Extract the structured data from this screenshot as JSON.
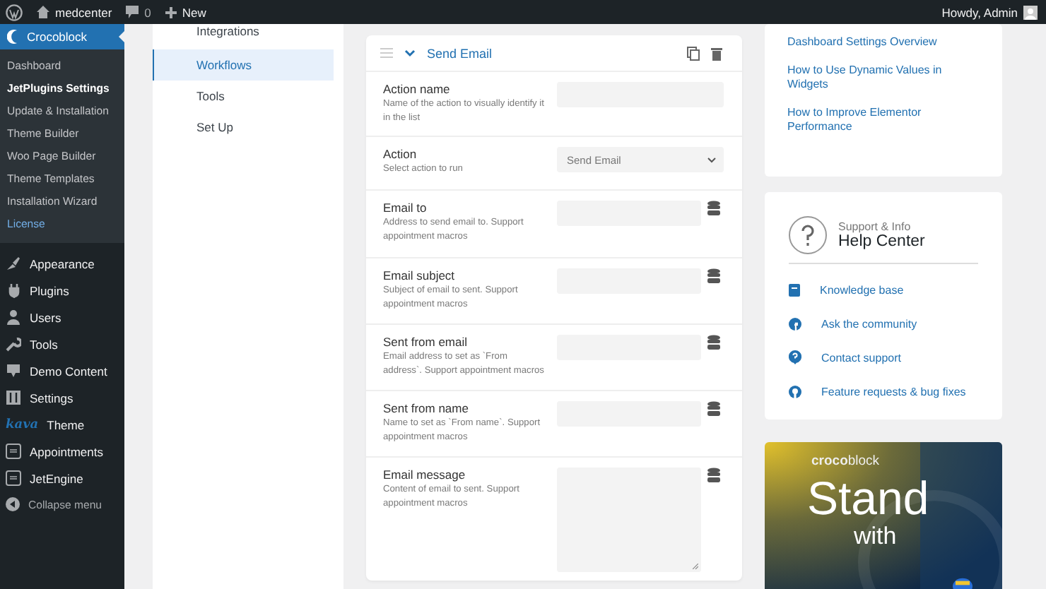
{
  "admin_bar": {
    "site": "medcenter",
    "comments": "0",
    "new": "New",
    "greeting": "Howdy, Admin"
  },
  "sidebar": {
    "header": "Crocoblock",
    "submenu": [
      {
        "label": "Dashboard",
        "selected": false,
        "kind": "plain"
      },
      {
        "label": "JetPlugins Settings",
        "selected": true,
        "kind": "plain"
      },
      {
        "label": "Update & Installation",
        "selected": false,
        "kind": "plain"
      },
      {
        "label": "Theme Builder",
        "selected": false,
        "kind": "plain"
      },
      {
        "label": "Woo Page Builder",
        "selected": false,
        "kind": "plain"
      },
      {
        "label": "Theme Templates",
        "selected": false,
        "kind": "plain"
      },
      {
        "label": "Installation Wizard",
        "selected": false,
        "kind": "plain"
      },
      {
        "label": "License",
        "selected": false,
        "kind": "accent"
      }
    ],
    "menu": [
      {
        "label": "Appearance",
        "kind": "brush"
      },
      {
        "label": "Plugins",
        "kind": "plug"
      },
      {
        "label": "Users",
        "kind": "user"
      },
      {
        "label": "Tools",
        "kind": "wrench"
      },
      {
        "label": "Demo Content",
        "kind": "download"
      },
      {
        "label": "Settings",
        "kind": "sliders"
      },
      {
        "label": "Theme",
        "kind": "brand",
        "brand": "kava"
      },
      {
        "label": "Appointments",
        "kind": "jet"
      },
      {
        "label": "JetEngine",
        "kind": "jet"
      }
    ],
    "collapse": "Collapse menu"
  },
  "settings_nav": [
    {
      "label": "Integrations",
      "selected": false
    },
    {
      "label": "Workflows",
      "selected": true
    },
    {
      "label": "Tools",
      "selected": false
    },
    {
      "label": "Set Up",
      "selected": false
    }
  ],
  "action_card": {
    "title": "Send Email",
    "expanded": true,
    "fields": [
      {
        "label": "Action name",
        "description": "Name of the action to visually identify it in the list",
        "kind": "input",
        "macros": false
      },
      {
        "label": "Action",
        "description": "Select action to run",
        "kind": "select",
        "value": "Send Email",
        "macros": false
      },
      {
        "label": "Email to",
        "description": "Address to send email to. Support appointment macros",
        "kind": "input",
        "macros": true
      },
      {
        "label": "Email subject",
        "description": "Subject of email to sent. Support appointment macros",
        "kind": "input",
        "macros": true
      },
      {
        "label": "Sent from email",
        "description": "Email address to set as `From address`. Support appointment macros",
        "kind": "input",
        "macros": true
      },
      {
        "label": "Sent from name",
        "description": "Name to set as `From name`. Support appointment macros",
        "kind": "input",
        "macros": true
      },
      {
        "label": "Email message",
        "description": "Content of email to sent. Support appointment macros",
        "kind": "textarea",
        "macros": true
      }
    ]
  },
  "guides": [
    "Dashboard Settings Overview",
    "How to Use Dynamic Values in Widgets",
    "How to Improve Elementor Performance"
  ],
  "help_center": {
    "eyebrow": "Support & Info",
    "title": "Help Center",
    "links": [
      {
        "label": "Knowledge base",
        "kind": "book"
      },
      {
        "label": "Ask the community",
        "kind": "facebook"
      },
      {
        "label": "Contact support",
        "kind": "question"
      },
      {
        "label": "Feature requests & bug fixes",
        "kind": "github"
      }
    ]
  },
  "banner": {
    "logo_bold": "croco",
    "logo_light": "block",
    "line1": "Stand",
    "line2": "with"
  }
}
